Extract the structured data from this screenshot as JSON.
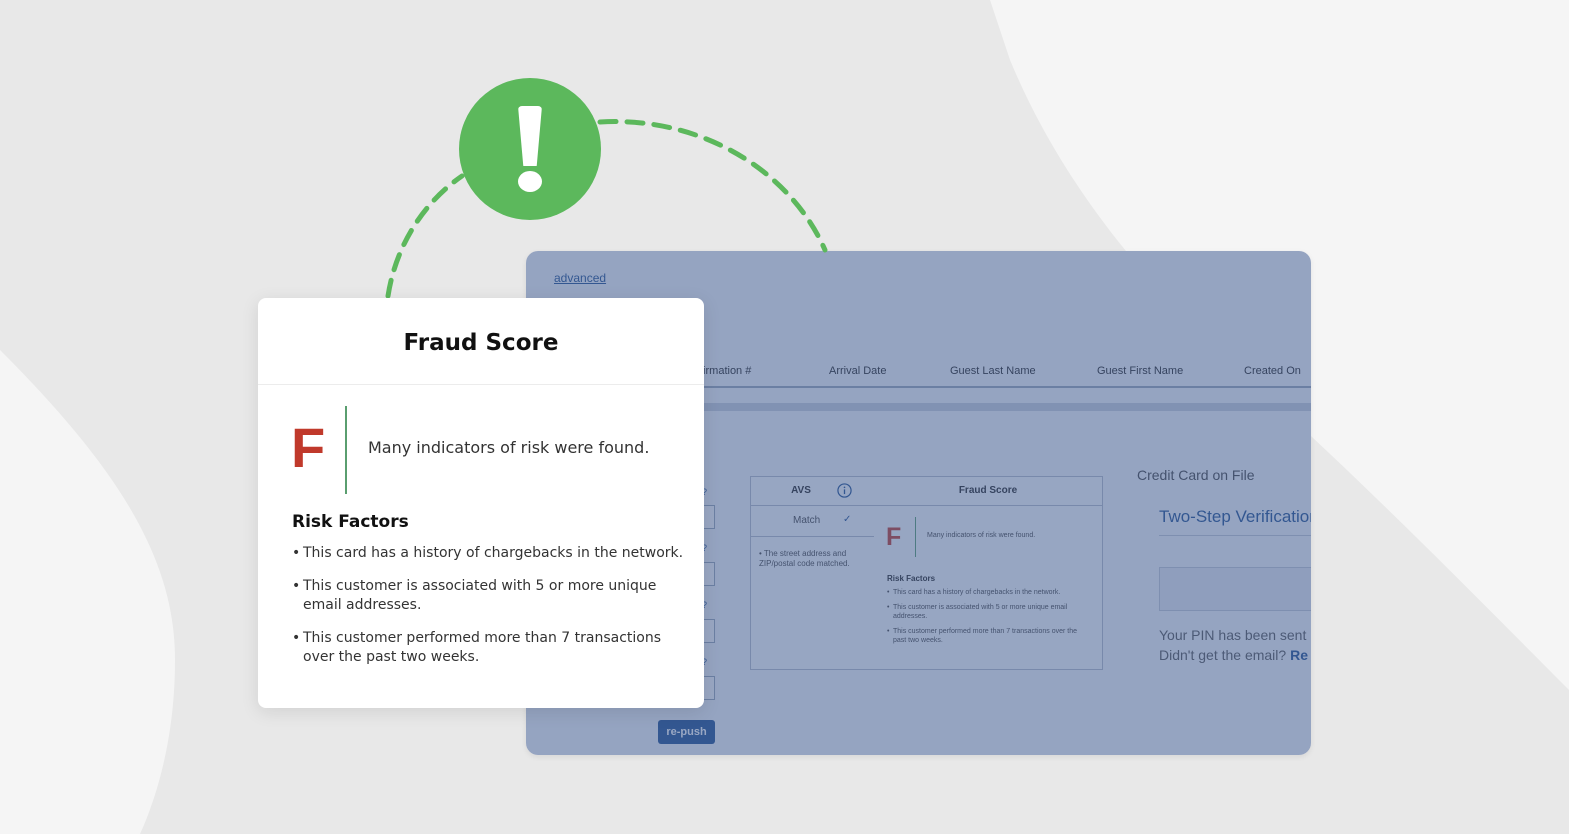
{
  "colors": {
    "accent_green": "#5cb85c",
    "grade_red": "#c0392b",
    "link_blue": "#1d4f91",
    "overlay_blue": "#465f91"
  },
  "badge": {
    "icon": "exclamation-icon"
  },
  "fraud_card": {
    "title": "Fraud Score",
    "grade": "F",
    "summary": "Many indicators of risk were found.",
    "risk_factors_title": "Risk Factors",
    "risk_factors": [
      "This card has a history of chargebacks in the network.",
      "This customer is associated with 5 or more unique email addresses.",
      "This customer performed more than 7 transactions over the past two weeks."
    ]
  },
  "background_app": {
    "advanced_link": "advanced",
    "columns": [
      "firmation #",
      "Arrival Date",
      "Guest Last Name",
      "Guest First Name",
      "Created On"
    ],
    "repush_label": "re-push",
    "avs": {
      "title": "AVS",
      "info_icon": "info-icon",
      "match_label": "Match",
      "check_icon": "check-icon",
      "note": "• The street address and ZIP/postal code matched."
    },
    "mini_fraud": {
      "title": "Fraud Score",
      "grade": "F",
      "summary": "Many indicators of risk were found.",
      "risk_factors_title": "Risk Factors",
      "risk_factors": [
        "This card has a history of chargebacks in the network.",
        "This customer is associated with 5 or more unique email addresses.",
        "This customer performed more than 7 transactions over the past two weeks."
      ]
    },
    "credit_card": {
      "title": "Credit Card on File",
      "verification_title": "Two-Step Verification",
      "pin_sent": "Your PIN has been sent",
      "didnt_get": "Didn't get the email?",
      "resend_link": "Re"
    }
  }
}
